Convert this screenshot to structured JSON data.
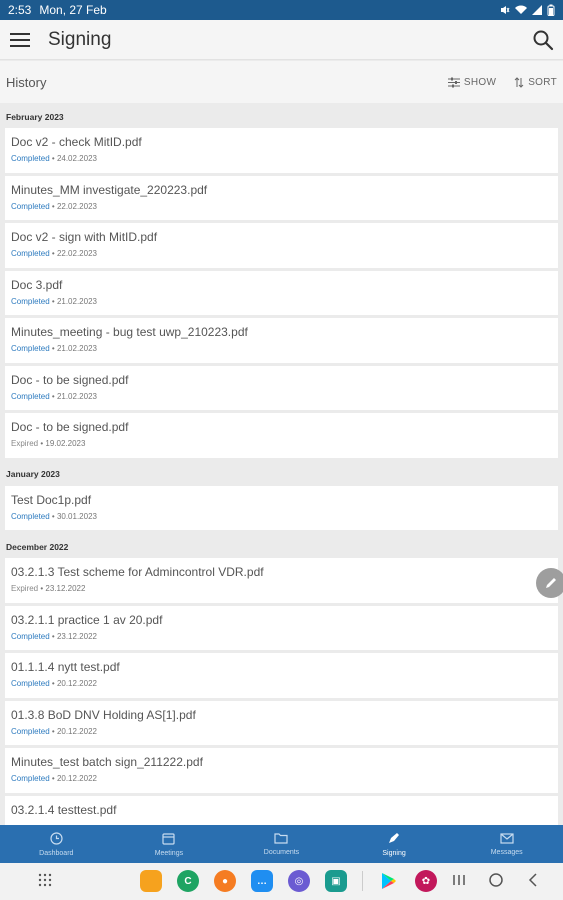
{
  "status_bar": {
    "time": "2:53",
    "date": "Mon, 27 Feb"
  },
  "app_bar": {
    "title": "Signing"
  },
  "sub_bar": {
    "history_label": "History",
    "show_label": "SHOW",
    "sort_label": "SORT"
  },
  "groups": [
    {
      "header": "February 2023",
      "items": [
        {
          "name": "Doc v2 - check MitID.pdf",
          "status": "Completed",
          "date": "24.02.2023"
        },
        {
          "name": "Minutes_MM investigate_220223.pdf",
          "status": "Completed",
          "date": "22.02.2023"
        },
        {
          "name": "Doc v2 - sign with MitID.pdf",
          "status": "Completed",
          "date": "22.02.2023"
        },
        {
          "name": "Doc 3.pdf",
          "status": "Completed",
          "date": "21.02.2023"
        },
        {
          "name": "Minutes_meeting - bug test uwp_210223.pdf",
          "status": "Completed",
          "date": "21.02.2023"
        },
        {
          "name": "Doc - to be signed.pdf",
          "status": "Completed",
          "date": "21.02.2023"
        },
        {
          "name": "Doc - to be signed.pdf",
          "status": "Expired",
          "date": "19.02.2023"
        }
      ]
    },
    {
      "header": "January 2023",
      "items": [
        {
          "name": "Test Doc1p.pdf",
          "status": "Completed",
          "date": "30.01.2023"
        }
      ]
    },
    {
      "header": "December 2022",
      "items": [
        {
          "name": "03.2.1.3 Test scheme for Admincontrol VDR.pdf",
          "status": "Expired",
          "date": "23.12.2022"
        },
        {
          "name": "03.2.1.1 practice 1 av 20.pdf",
          "status": "Completed",
          "date": "23.12.2022"
        },
        {
          "name": "01.1.1.4 nytt test.pdf",
          "status": "Completed",
          "date": "20.12.2022"
        },
        {
          "name": "01.3.8 BoD DNV Holding AS[1].pdf",
          "status": "Completed",
          "date": "20.12.2022"
        },
        {
          "name": "Minutes_test batch sign_211222.pdf",
          "status": "Completed",
          "date": "20.12.2022"
        },
        {
          "name": "03.2.1.4 testtest.pdf",
          "status": "",
          "date": ""
        }
      ]
    }
  ],
  "bottom_nav": [
    {
      "label": "Dashboard",
      "icon": "clock-icon"
    },
    {
      "label": "Meetings",
      "icon": "calendar-icon"
    },
    {
      "label": "Documents",
      "icon": "folder-icon"
    },
    {
      "label": "Signing",
      "icon": "pen-icon"
    },
    {
      "label": "Messages",
      "icon": "mail-icon"
    }
  ],
  "active_tab": "Signing",
  "colors": {
    "status_bar": "#1d5a8e",
    "bottom_nav": "#2a6fb0",
    "status_link": "#2e7bbf"
  }
}
